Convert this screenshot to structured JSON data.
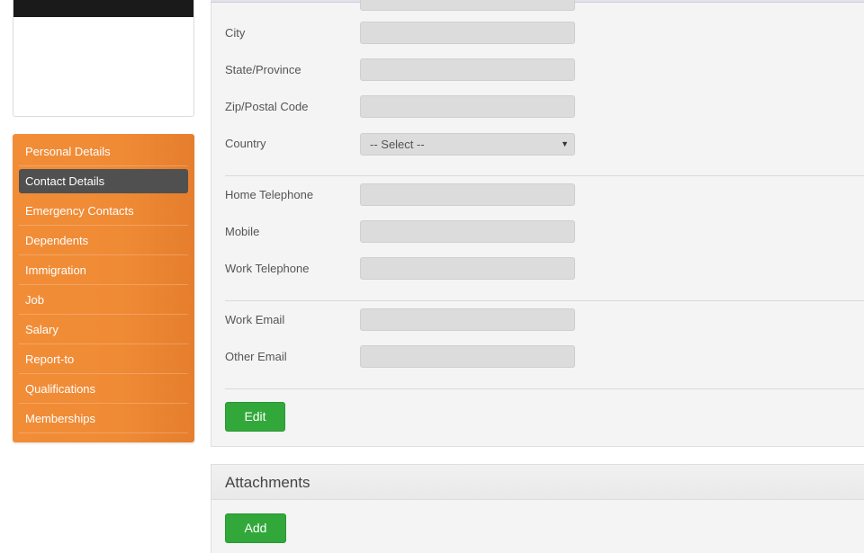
{
  "sidebar": {
    "items": [
      {
        "label": "Personal Details",
        "active": false
      },
      {
        "label": "Contact Details",
        "active": true
      },
      {
        "label": "Emergency Contacts",
        "active": false
      },
      {
        "label": "Dependents",
        "active": false
      },
      {
        "label": "Immigration",
        "active": false
      },
      {
        "label": "Job",
        "active": false
      },
      {
        "label": "Salary",
        "active": false
      },
      {
        "label": "Report-to",
        "active": false
      },
      {
        "label": "Qualifications",
        "active": false
      },
      {
        "label": "Memberships",
        "active": false
      }
    ]
  },
  "contact_form": {
    "city": {
      "label": "City",
      "value": ""
    },
    "state": {
      "label": "State/Province",
      "value": ""
    },
    "zip": {
      "label": "Zip/Postal Code",
      "value": ""
    },
    "country": {
      "label": "Country",
      "selected": "-- Select --"
    },
    "home_phone": {
      "label": "Home Telephone",
      "value": ""
    },
    "mobile": {
      "label": "Mobile",
      "value": ""
    },
    "work_phone": {
      "label": "Work Telephone",
      "value": ""
    },
    "work_email": {
      "label": "Work Email",
      "value": ""
    },
    "other_email": {
      "label": "Other Email",
      "value": ""
    },
    "edit_label": "Edit"
  },
  "attachments": {
    "title": "Attachments",
    "add_label": "Add"
  },
  "colors": {
    "menu_orange": "#f28d37",
    "menu_active": "#505050",
    "button_green": "#32a83b"
  }
}
